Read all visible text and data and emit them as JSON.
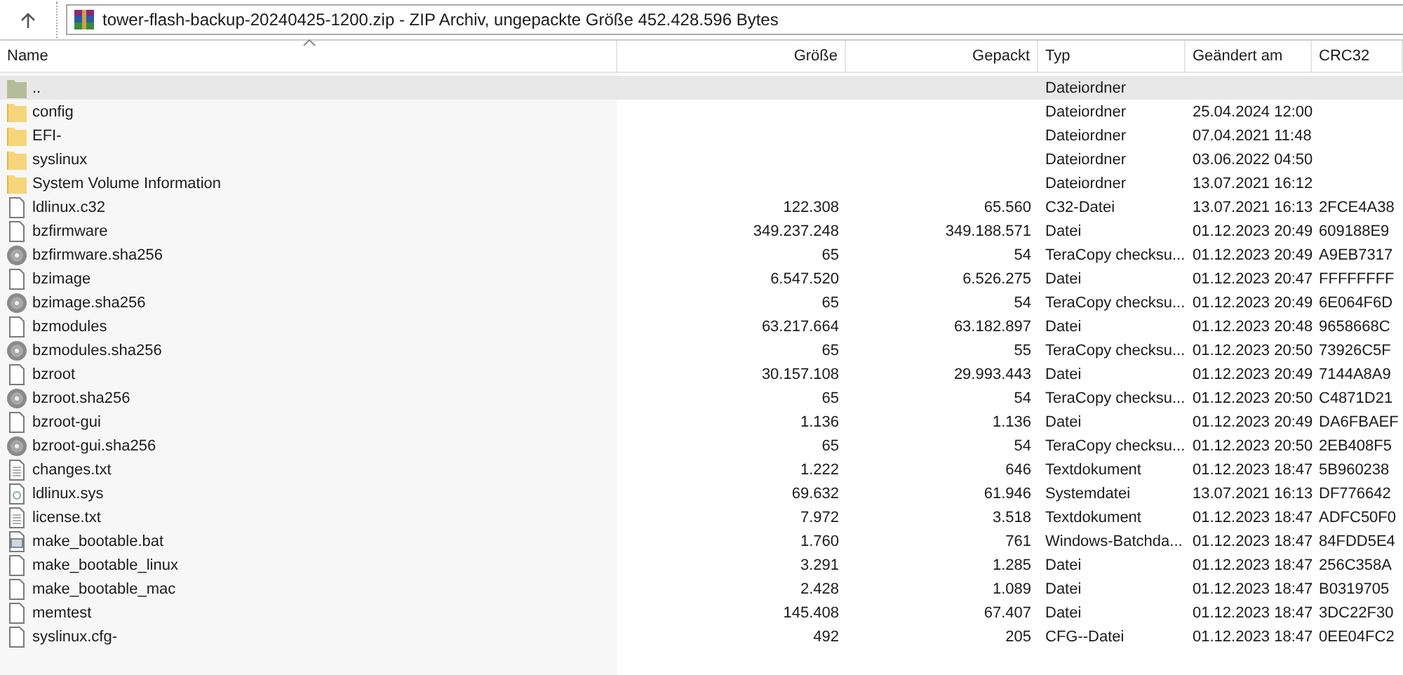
{
  "path_bar": {
    "text": "tower-flash-backup-20240425-1200.zip - ZIP Archiv, ungepackte Größe 452.428.596 Bytes"
  },
  "table": {
    "columns": [
      {
        "label": "Name",
        "sorted": true
      },
      {
        "label": "Größe",
        "sorted": false
      },
      {
        "label": "Gepackt",
        "sorted": false
      },
      {
        "label": "Typ",
        "sorted": false
      },
      {
        "label": "Geändert am",
        "sorted": false
      },
      {
        "label": "CRC32",
        "sorted": false
      }
    ],
    "rows": [
      {
        "kind": "parent",
        "selected": true,
        "cells": [
          "..",
          "",
          "",
          "Dateiordner",
          "",
          ""
        ]
      },
      {
        "kind": "folder",
        "selected": false,
        "cells": [
          "config",
          "",
          "",
          "Dateiordner",
          "25.04.2024 12:00",
          ""
        ]
      },
      {
        "kind": "folder",
        "selected": false,
        "cells": [
          "EFI-",
          "",
          "",
          "Dateiordner",
          "07.04.2021 11:48",
          ""
        ]
      },
      {
        "kind": "folder",
        "selected": false,
        "cells": [
          "syslinux",
          "",
          "",
          "Dateiordner",
          "03.06.2022 04:50",
          ""
        ]
      },
      {
        "kind": "folder",
        "selected": false,
        "cells": [
          "System Volume Information",
          "",
          "",
          "Dateiordner",
          "13.07.2021 16:12",
          ""
        ]
      },
      {
        "kind": "file",
        "selected": false,
        "cells": [
          "ldlinux.c32",
          "122.308",
          "65.560",
          "C32-Datei",
          "13.07.2021 16:13",
          "2FCE4A38"
        ]
      },
      {
        "kind": "file",
        "selected": false,
        "cells": [
          "bzfirmware",
          "349.237.248",
          "349.188.571",
          "Datei",
          "01.12.2023 20:49",
          "609188E9"
        ]
      },
      {
        "kind": "disc",
        "selected": false,
        "cells": [
          "bzfirmware.sha256",
          "65",
          "54",
          "TeraCopy checksu...",
          "01.12.2023 20:49",
          "A9EB7317"
        ]
      },
      {
        "kind": "file",
        "selected": false,
        "cells": [
          "bzimage",
          "6.547.520",
          "6.526.275",
          "Datei",
          "01.12.2023 20:47",
          "FFFFFFFF"
        ]
      },
      {
        "kind": "disc",
        "selected": false,
        "cells": [
          "bzimage.sha256",
          "65",
          "54",
          "TeraCopy checksu...",
          "01.12.2023 20:49",
          "6E064F6D"
        ]
      },
      {
        "kind": "file",
        "selected": false,
        "cells": [
          "bzmodules",
          "63.217.664",
          "63.182.897",
          "Datei",
          "01.12.2023 20:48",
          "9658668C"
        ]
      },
      {
        "kind": "disc",
        "selected": false,
        "cells": [
          "bzmodules.sha256",
          "65",
          "55",
          "TeraCopy checksu...",
          "01.12.2023 20:50",
          "73926C5F"
        ]
      },
      {
        "kind": "file",
        "selected": false,
        "cells": [
          "bzroot",
          "30.157.108",
          "29.993.443",
          "Datei",
          "01.12.2023 20:49",
          "7144A8A9"
        ]
      },
      {
        "kind": "disc",
        "selected": false,
        "cells": [
          "bzroot.sha256",
          "65",
          "54",
          "TeraCopy checksu...",
          "01.12.2023 20:50",
          "C4871D21"
        ]
      },
      {
        "kind": "file",
        "selected": false,
        "cells": [
          "bzroot-gui",
          "1.136",
          "1.136",
          "Datei",
          "01.12.2023 20:49",
          "DA6FBAEF"
        ]
      },
      {
        "kind": "disc",
        "selected": false,
        "cells": [
          "bzroot-gui.sha256",
          "65",
          "54",
          "TeraCopy checksu...",
          "01.12.2023 20:50",
          "2EB408F5"
        ]
      },
      {
        "kind": "text",
        "selected": false,
        "cells": [
          "changes.txt",
          "1.222",
          "646",
          "Textdokument",
          "01.12.2023 18:47",
          "5B960238"
        ]
      },
      {
        "kind": "system",
        "selected": false,
        "cells": [
          "ldlinux.sys",
          "69.632",
          "61.946",
          "Systemdatei",
          "13.07.2021 16:13",
          "DF776642"
        ]
      },
      {
        "kind": "text",
        "selected": false,
        "cells": [
          "license.txt",
          "7.972",
          "3.518",
          "Textdokument",
          "01.12.2023 18:47",
          "ADFC50F0"
        ]
      },
      {
        "kind": "batch",
        "selected": false,
        "cells": [
          "make_bootable.bat",
          "1.760",
          "761",
          "Windows-Batchda...",
          "01.12.2023 18:47",
          "84FDD5E4"
        ]
      },
      {
        "kind": "file",
        "selected": false,
        "cells": [
          "make_bootable_linux",
          "3.291",
          "1.285",
          "Datei",
          "01.12.2023 18:47",
          "256C358A"
        ]
      },
      {
        "kind": "file",
        "selected": false,
        "cells": [
          "make_bootable_mac",
          "2.428",
          "1.089",
          "Datei",
          "01.12.2023 18:47",
          "B0319705"
        ]
      },
      {
        "kind": "file",
        "selected": false,
        "cells": [
          "memtest",
          "145.408",
          "67.407",
          "Datei",
          "01.12.2023 18:47",
          "3DC22F30"
        ]
      },
      {
        "kind": "file",
        "selected": false,
        "cells": [
          "syslinux.cfg-",
          "492",
          "205",
          "CFG--Datei",
          "01.12.2023 18:47",
          "0EE04FC2"
        ]
      }
    ]
  }
}
